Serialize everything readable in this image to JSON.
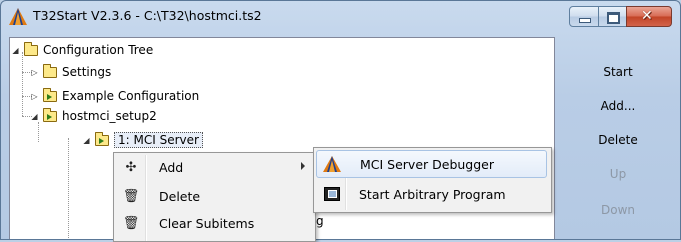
{
  "window": {
    "title": "T32Start V2.3.6 - C:\\T32\\hostmci.ts2",
    "min_icon": "minimize-icon",
    "max_icon": "maximize-icon",
    "close_icon": "close-icon"
  },
  "tree": {
    "root": "Configuration Tree",
    "items": [
      {
        "label": "Settings"
      },
      {
        "label": "Example Configuration"
      },
      {
        "label": "hostmci_setup2"
      },
      {
        "label": "1: MCI Server"
      }
    ],
    "peek_text": "g"
  },
  "side_buttons": {
    "start": "Start",
    "add": "Add...",
    "delete": "Delete",
    "up": "Up",
    "down": "Down"
  },
  "context_menu": {
    "items": [
      {
        "label": "Add",
        "icon": "✣",
        "icon_name": "add-icon"
      },
      {
        "label": "Delete",
        "icon": "🗑",
        "icon_name": "trash-icon"
      },
      {
        "label": "Clear Subitems",
        "icon": "🗑",
        "icon_name": "clear-icon"
      }
    ]
  },
  "submenu": {
    "items": [
      {
        "label": "MCI Server Debugger",
        "icon_name": "trace32-icon"
      },
      {
        "label": "Start Arbitrary Program",
        "icon_name": "program-icon"
      }
    ]
  },
  "colors": {
    "accent_highlight": "#e3ecf9",
    "titlebar": "#c9daee",
    "close_button": "#c24427",
    "disabled_text": "#8d98a6"
  }
}
